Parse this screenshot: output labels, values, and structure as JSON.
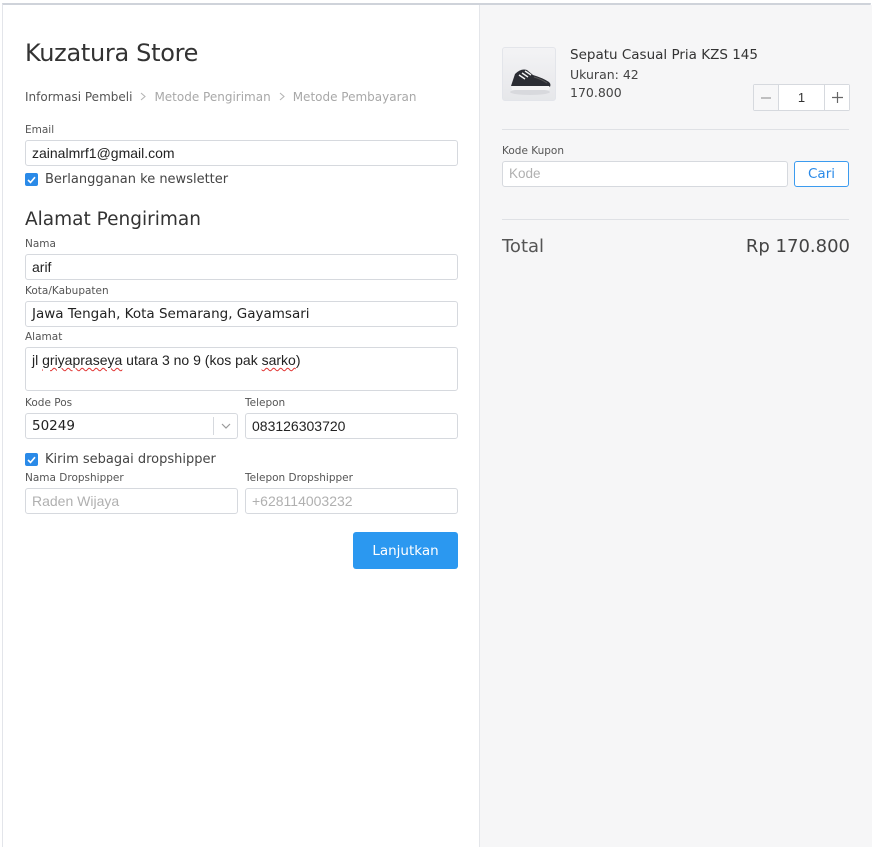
{
  "store": {
    "title": "Kuzatura Store"
  },
  "breadcrumb": {
    "items": [
      "Informasi Pembeli",
      "Metode Pengiriman",
      "Metode Pembayaran"
    ],
    "separator": ">"
  },
  "contact": {
    "email_label": "Email",
    "email_value": "zainalmrf1@gmail.com",
    "newsletter_label": "Berlangganan ke newsletter",
    "newsletter_checked": true
  },
  "shipping": {
    "section_title": "Alamat Pengiriman",
    "name_label": "Nama",
    "name_value": "arif",
    "city_label": "Kota/Kabupaten",
    "city_value": "Jawa Tengah, Kota Semarang, Gayamsari",
    "address_label": "Alamat",
    "address_value_parts": [
      "jl ",
      "griyapraseya",
      " utara 3 no 9 (kos pak ",
      "sarko",
      ")"
    ],
    "postal_label": "Kode Pos",
    "postal_value": "50249",
    "phone_label": "Telepon",
    "phone_value": "083126303720"
  },
  "dropship": {
    "checkbox_label": "Kirim sebagai dropshipper",
    "checked": true,
    "name_label": "Nama Dropshipper",
    "name_placeholder": "Raden Wijaya",
    "phone_label": "Telepon Dropshipper",
    "phone_placeholder": "+628114003232"
  },
  "actions": {
    "continue_label": "Lanjutkan"
  },
  "cart": {
    "item": {
      "name": "Sepatu Casual Pria KZS 145",
      "size": "Ukuran: 42",
      "price": "170.800",
      "quantity": "1",
      "image_icon": "sneaker-icon"
    },
    "coupon": {
      "label": "Kode Kupon",
      "placeholder": "Kode",
      "button_label": "Cari"
    },
    "total_label": "Total",
    "total_value": "Rp 170.800"
  },
  "colors": {
    "accent": "#2b98f0",
    "panel_bg": "#f6f6f7",
    "border": "#d6d9de"
  }
}
